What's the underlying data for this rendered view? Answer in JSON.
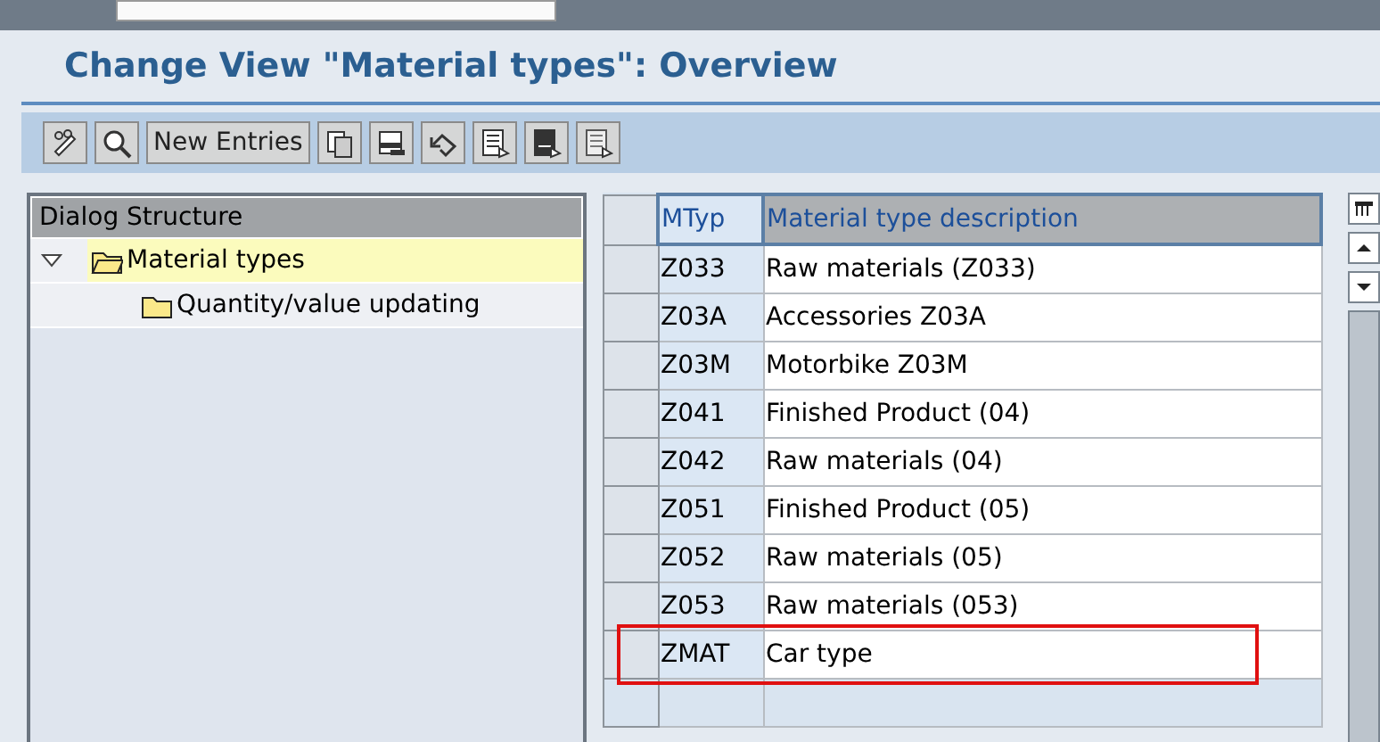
{
  "title": "Change View \"Material types\": Overview",
  "toolbar": [
    {
      "kind": "edit"
    },
    {
      "kind": "find"
    },
    {
      "kind": "text",
      "label": "New Entries"
    },
    {
      "kind": "copy"
    },
    {
      "kind": "delete"
    },
    {
      "kind": "undo"
    },
    {
      "kind": "select-all"
    },
    {
      "kind": "select-block"
    },
    {
      "kind": "deselect"
    }
  ],
  "tree": {
    "header": "Dialog Structure",
    "items": [
      {
        "label": "Material types",
        "expanded": true,
        "selected": true,
        "children": [
          {
            "label": "Quantity/value updating",
            "selected": false
          }
        ]
      }
    ]
  },
  "table": {
    "columns": [
      "MTyp",
      "Material type description"
    ],
    "rows": [
      {
        "cells": [
          "Z033",
          "Raw materials (Z033)"
        ],
        "highlighted": false
      },
      {
        "cells": [
          "Z03A",
          "Accessories Z03A"
        ],
        "highlighted": false
      },
      {
        "cells": [
          "Z03M",
          "Motorbike Z03M"
        ],
        "highlighted": false
      },
      {
        "cells": [
          "Z041",
          "Finished Product (04)"
        ],
        "highlighted": false
      },
      {
        "cells": [
          "Z042",
          "Raw materials (04)"
        ],
        "highlighted": false
      },
      {
        "cells": [
          "Z051",
          "Finished Product (05)"
        ],
        "highlighted": false
      },
      {
        "cells": [
          "Z052",
          "Raw materials (05)"
        ],
        "highlighted": false
      },
      {
        "cells": [
          "Z053",
          "Raw materials (053)"
        ],
        "highlighted": false
      },
      {
        "cells": [
          "ZMAT",
          "Car type"
        ],
        "highlighted": true
      }
    ]
  }
}
